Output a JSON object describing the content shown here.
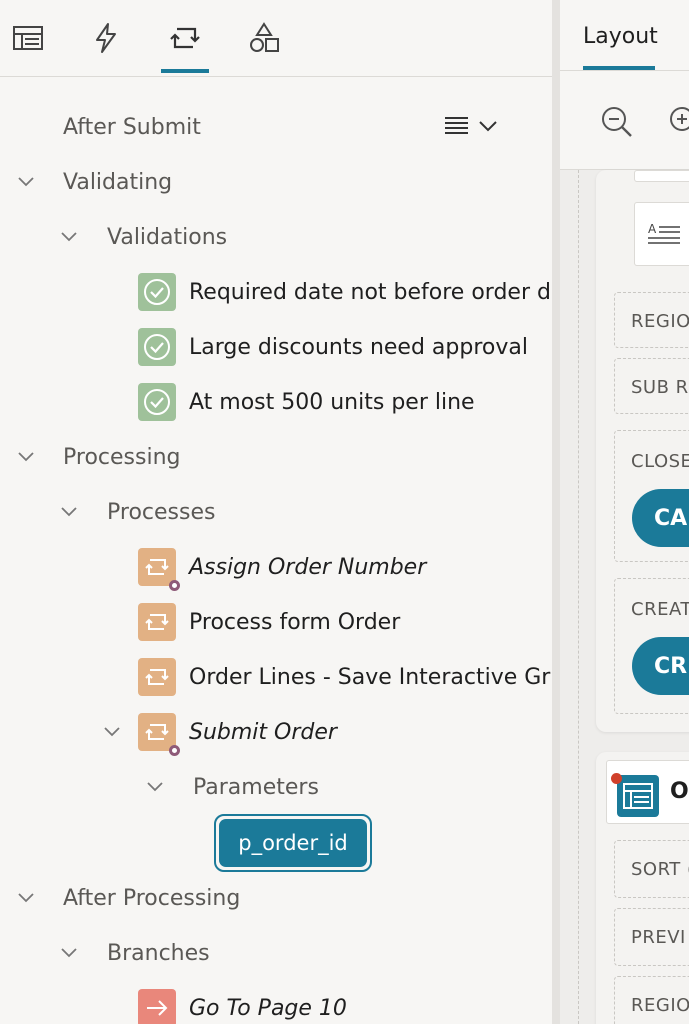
{
  "toolbar": {
    "icons": [
      "layout-icon",
      "lightning-icon",
      "processing-icon",
      "shapes-icon"
    ],
    "active_index": 2
  },
  "tree": {
    "after_submit": "After Submit",
    "validating": "Validating",
    "validations": "Validations",
    "validation_items": [
      "Required date not before order date",
      "Large discounts need approval",
      "At most 500 units per line"
    ],
    "processing": "Processing",
    "processes": "Processes",
    "process_items": [
      {
        "label": "Assign Order Number",
        "italic": true
      },
      {
        "label": "Process form Order",
        "italic": false
      },
      {
        "label": "Order Lines - Save Interactive Grid Data",
        "italic": false
      },
      {
        "label": "Submit Order",
        "italic": true
      }
    ],
    "parameters": "Parameters",
    "selected_parameter": "p_order_id",
    "after_processing": "After Processing",
    "branches": "Branches",
    "branch_items": [
      {
        "label": "Go To Page 10",
        "italic": true
      }
    ]
  },
  "right": {
    "tab_label": "Layout",
    "slots_top": [
      "REGIO",
      "SUB RI",
      "CLOSE",
      "CREAT"
    ],
    "buttons": [
      "CA",
      "CR"
    ],
    "region_title": "Or",
    "slots_bottom": [
      "SORT (",
      "PREVI",
      "REGIO"
    ]
  },
  "colors": {
    "accent": "#1b7a99",
    "validation": "#9fc19a",
    "process": "#e2b184",
    "branch": "#e9877b"
  }
}
